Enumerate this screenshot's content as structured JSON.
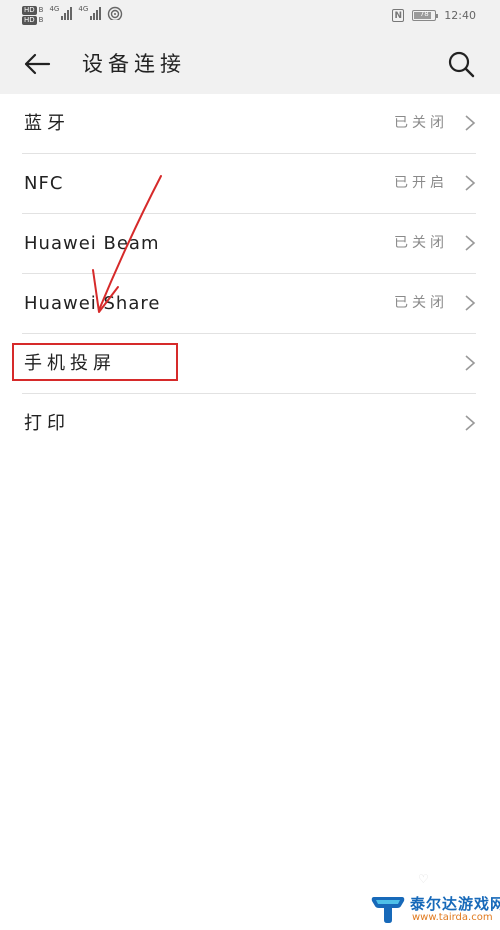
{
  "status_bar": {
    "hd_badges": [
      "HD",
      "HD"
    ],
    "sim_labels": [
      "B",
      "B"
    ],
    "network_types": [
      "4G",
      "4G"
    ],
    "battery_level": "78",
    "time": "12:40"
  },
  "app_bar": {
    "title": "设备连接",
    "back_icon": "arrow-left-icon",
    "search_icon": "search-icon"
  },
  "settings": [
    {
      "label": "蓝牙",
      "status": "已关闭"
    },
    {
      "label": "NFC",
      "status": "已开启"
    },
    {
      "label": "Huawei Beam",
      "status": "已关闭"
    },
    {
      "label": "Huawei Share",
      "status": "已关闭"
    },
    {
      "label": "手机投屏",
      "status": ""
    },
    {
      "label": "打印",
      "status": ""
    }
  ],
  "annotation": {
    "color": "#d62a2a",
    "highlighted_item": "手机投屏"
  },
  "watermark": {
    "name": "泰尔达游戏网",
    "url": "www.tairda.com"
  },
  "colors": {
    "background": "#ffffff",
    "appbar": "#f1f1f1",
    "divider": "#e2e2e2",
    "status_text": "#8a8a8a"
  }
}
